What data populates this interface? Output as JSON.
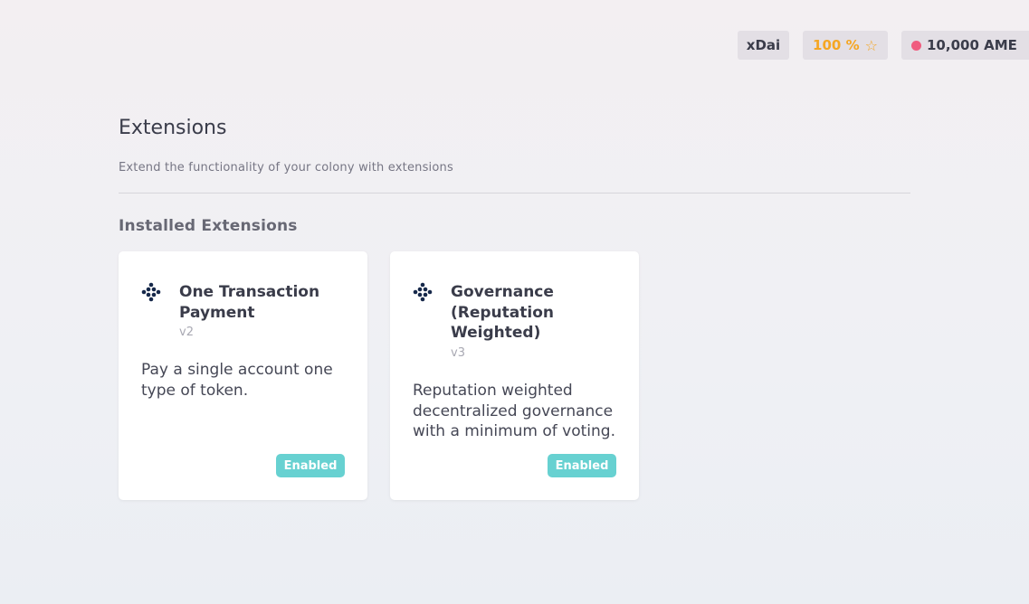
{
  "header": {
    "network": "xDai",
    "reputation": "100 %",
    "reputation_icon": "star-outline-icon",
    "token_balance": "10,000 AME",
    "token_dot_color": "#f05c7f"
  },
  "page": {
    "title": "Extensions",
    "subtitle": "Extend the functionality of your colony with extensions",
    "section_title": "Installed Extensions"
  },
  "extensions": [
    {
      "name": "One Transaction Payment",
      "version": "v2",
      "description": "Pay a single account one type of token.",
      "status": "Enabled",
      "icon": "extension-dots-icon"
    },
    {
      "name": "Governance (Reputation Weighted)",
      "version": "v3",
      "description": "Reputation weighted decentralized governance with a minimum of voting.",
      "status": "Enabled",
      "icon": "extension-dots-icon"
    }
  ],
  "colors": {
    "enabled_badge": "#67d1d1",
    "reputation_text": "#f5a623",
    "icon_dark": "#16284a"
  }
}
